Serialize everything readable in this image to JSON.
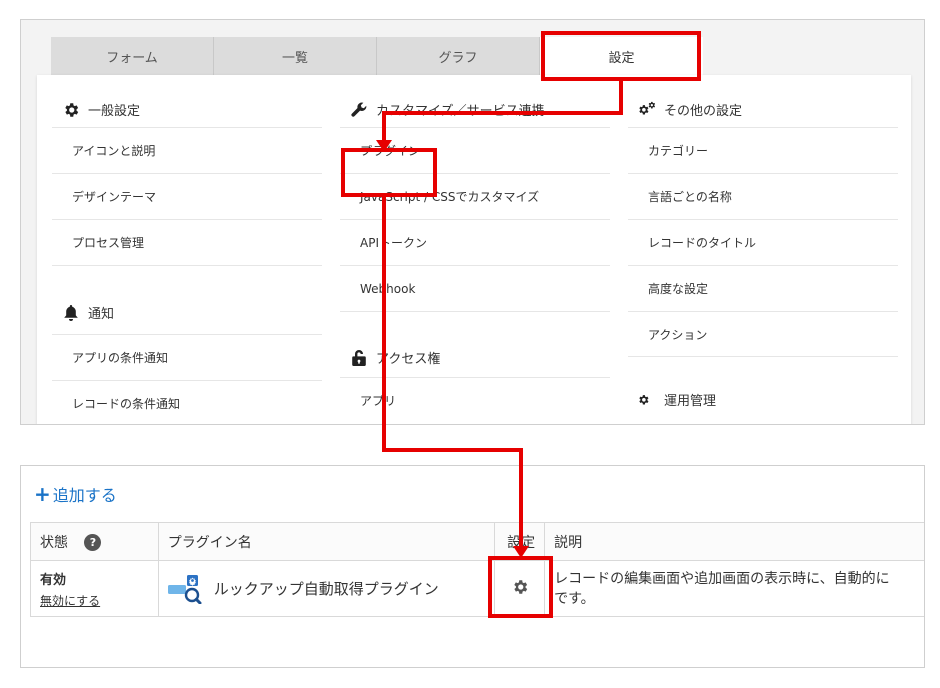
{
  "tabs": [
    "フォーム",
    "一覧",
    "グラフ",
    "設定"
  ],
  "col1": {
    "general": {
      "title": "一般設定",
      "icon": "gear-icon",
      "items": [
        "アイコンと説明",
        "デザインテーマ",
        "プロセス管理"
      ]
    },
    "notify": {
      "title": "通知",
      "icon": "bell-icon",
      "items": [
        "アプリの条件通知",
        "レコードの条件通知"
      ]
    }
  },
  "col2": {
    "custom": {
      "title": "カスタマイズ／サービス連携",
      "icon": "wrench-icon",
      "items": [
        "プラグイン",
        "JavaScript / CSSでカスタマイズ",
        "APIトークン",
        "Webhook"
      ]
    },
    "access": {
      "title": "アクセス権",
      "icon": "lock-icon",
      "items": [
        "アプリ"
      ]
    }
  },
  "col3": {
    "other": {
      "title": "その他の設定",
      "icon": "gears-icon",
      "items": [
        "カテゴリー",
        "言語ごとの名称",
        "レコードのタイトル",
        "高度な設定",
        "アクション"
      ]
    },
    "ops": {
      "title": "運用管理",
      "icon": "gears-icon"
    }
  },
  "plugins": {
    "add_label": "追加する",
    "headers": {
      "status": "状態",
      "name": "プラグイン名",
      "settings": "設定",
      "description": "説明"
    },
    "rows": [
      {
        "status": "有効",
        "action": "無効にする",
        "name": "ルックアップ自動取得プラグイン",
        "description_line1": "レコードの編集画面や追加画面の表示時に、自動的に",
        "description_line2": "です。"
      }
    ]
  },
  "colors": {
    "highlight": "#e60000",
    "link": "#1a73c7",
    "tab_bg": "#dcdcdc"
  }
}
